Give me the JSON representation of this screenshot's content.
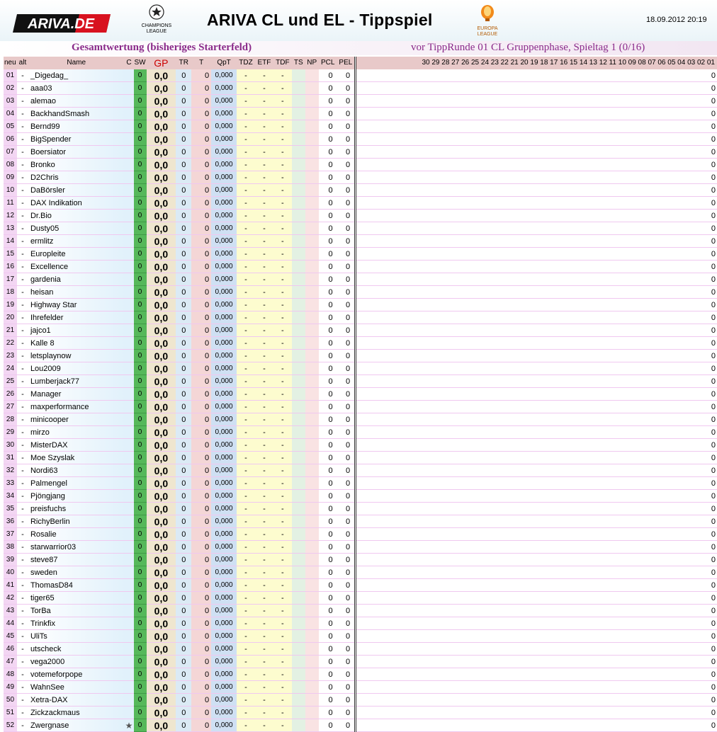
{
  "header": {
    "brand": "ARIVA.DE",
    "title": "ARIVA CL und EL - Tippspiel",
    "datetime": "18.09.2012 20:19",
    "cl_logo_text": "CHAMPIONS LEAGUE",
    "el_logo_text": "EUROPA LEAGUE"
  },
  "subheader": {
    "left": "Gesamtwertung (bisheriges Starterfeld)",
    "right": "vor TippRunde 01 CL Gruppenphase, Spieltag 1 (0/16)"
  },
  "columns": {
    "neu": "neu",
    "alt": "alt",
    "name": "Name",
    "c": "C",
    "sw": "SW",
    "gp": "GP",
    "tr": "TR",
    "t": "T",
    "qpt": "QpT",
    "tdz": "TDZ",
    "etf": "ETF",
    "tdf": "TDF",
    "ts": "TS",
    "np": "NP",
    "pcl": "PCL",
    "pel": "PEL",
    "rounds": "30 29 28 27 26 25 24 23 22 21 20 19 18 17 16 15 14 13 12 11 10 09 08 07 06 05 04 03 02 01"
  },
  "defaults": {
    "alt": "-",
    "sw": "0",
    "gp": "0,0",
    "tr": "0",
    "t": "0",
    "qpt": "0,000",
    "tdz": "-",
    "etf": "-",
    "tdf": "-",
    "ts": "",
    "np": "",
    "pcl": "0",
    "pel": "0",
    "rest": "0"
  },
  "players": [
    {
      "rank": "01",
      "name": "_Digedag_"
    },
    {
      "rank": "02",
      "name": "aaa03"
    },
    {
      "rank": "03",
      "name": "alemao"
    },
    {
      "rank": "04",
      "name": "BackhandSmash"
    },
    {
      "rank": "05",
      "name": "Bernd99"
    },
    {
      "rank": "06",
      "name": "BigSpender"
    },
    {
      "rank": "07",
      "name": "Boersiator"
    },
    {
      "rank": "08",
      "name": "Bronko"
    },
    {
      "rank": "09",
      "name": "D2Chris"
    },
    {
      "rank": "10",
      "name": "DaBörsler"
    },
    {
      "rank": "11",
      "name": "DAX Indikation"
    },
    {
      "rank": "12",
      "name": "Dr.Bio"
    },
    {
      "rank": "13",
      "name": "Dusty05"
    },
    {
      "rank": "14",
      "name": "ermlitz"
    },
    {
      "rank": "15",
      "name": "Europleite"
    },
    {
      "rank": "16",
      "name": "Excellence"
    },
    {
      "rank": "17",
      "name": "gardenia"
    },
    {
      "rank": "18",
      "name": "heisan"
    },
    {
      "rank": "19",
      "name": "Highway Star"
    },
    {
      "rank": "20",
      "name": "Ihrefelder"
    },
    {
      "rank": "21",
      "name": "jajco1"
    },
    {
      "rank": "22",
      "name": "Kalle 8"
    },
    {
      "rank": "23",
      "name": "letsplaynow"
    },
    {
      "rank": "24",
      "name": "Lou2009"
    },
    {
      "rank": "25",
      "name": "Lumberjack77"
    },
    {
      "rank": "26",
      "name": "Manager"
    },
    {
      "rank": "27",
      "name": "maxperformance"
    },
    {
      "rank": "28",
      "name": "minicooper"
    },
    {
      "rank": "29",
      "name": "mirzo"
    },
    {
      "rank": "30",
      "name": "MisterDAX"
    },
    {
      "rank": "31",
      "name": "Moe Szyslak"
    },
    {
      "rank": "32",
      "name": "Nordi63"
    },
    {
      "rank": "33",
      "name": "Palmengel"
    },
    {
      "rank": "34",
      "name": "Pjöngjang"
    },
    {
      "rank": "35",
      "name": "preisfuchs"
    },
    {
      "rank": "36",
      "name": "RichyBerlin"
    },
    {
      "rank": "37",
      "name": "Rosalie"
    },
    {
      "rank": "38",
      "name": "starwarrior03"
    },
    {
      "rank": "39",
      "name": "steve87"
    },
    {
      "rank": "40",
      "name": "sweden"
    },
    {
      "rank": "41",
      "name": "ThomasD84"
    },
    {
      "rank": "42",
      "name": "tiger65"
    },
    {
      "rank": "43",
      "name": "TorBa"
    },
    {
      "rank": "44",
      "name": "Trinkfix"
    },
    {
      "rank": "45",
      "name": "UliTs"
    },
    {
      "rank": "46",
      "name": "utscheck"
    },
    {
      "rank": "47",
      "name": "vega2000"
    },
    {
      "rank": "48",
      "name": "votemeforpope"
    },
    {
      "rank": "49",
      "name": "WahnSee"
    },
    {
      "rank": "50",
      "name": "Xetra-DAX"
    },
    {
      "rank": "51",
      "name": "Zickzackmaus"
    },
    {
      "rank": "52",
      "name": "Zwergnase",
      "c": "★"
    }
  ]
}
